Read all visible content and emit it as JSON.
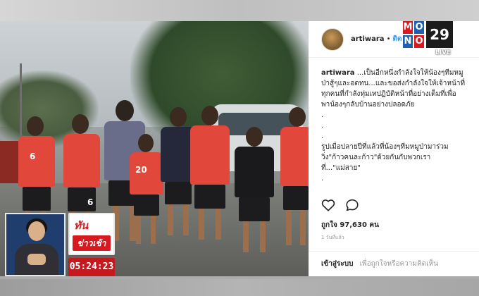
{
  "post": {
    "username": "artiwara",
    "separator": "•",
    "follow_label": "ติด",
    "caption_user": "artiwara",
    "caption_lines": [
      "...เป็นอีกหนึ่งกำลังใจให้น้องๆทีมหมู",
      "ป่าสู้ๆและอดทน...และขอส่งกำลังใจให้เจ้าหน้าที่",
      "ทุกคนที่กำลังทุ่มเทปฏิบัติหน้าที่อย่างเต็มที่เพื่อ",
      "พาน้องๆกลับบ้านอย่างปลอดภัย"
    ],
    "dots": [
      ".",
      ".",
      "."
    ],
    "caption_lines_2": [
      "รูปเมื่อปลายปีที่แล้วที่น้องๆทีมหมูป่ามาร่วม",
      "วิ่ง\"ก้าวคนละก้าว\"ด้วยกันกับพวกเรา",
      "ที่...\"แม่สาย\""
    ],
    "dot_end": ".",
    "likes": "ถูกใจ 97,630 คน",
    "time": "1 วันที่แล้ว",
    "login_link": "เข้าสู่ระบบ",
    "login_text": "เพื่อถูกใจหรือความคิดเห็น",
    "jersey_numbers": [
      "6",
      "6",
      "20"
    ]
  },
  "broadcast": {
    "logo_letters": [
      "M",
      "O",
      "N",
      "O"
    ],
    "logo_number": "29",
    "logo_live": "LIVE",
    "program_top": "ทัน",
    "program_bottom": "ข่าวเช้า",
    "clock": "05:24:23"
  },
  "colors": {
    "logo_red": "#d71920",
    "logo_blue": "#1f5fae",
    "jersey_red": "#e2473b",
    "link_blue": "#3897f0"
  }
}
